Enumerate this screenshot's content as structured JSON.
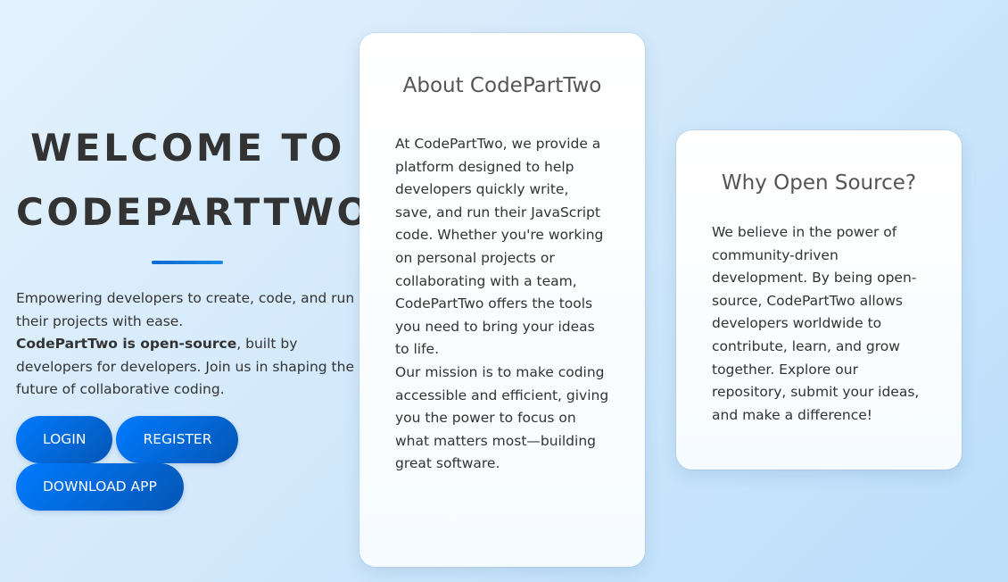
{
  "hero": {
    "title_line1": "WELCOME TO",
    "title_line2": "CODEPARTTWO",
    "intro": "Empowering developers to create, code, and run their projects with ease.",
    "open_source_strong": "CodePartTwo is open-source",
    "open_source_rest": ", built by developers for developers. Join us in shaping the future of collaborative coding.",
    "buttons": {
      "login": "LOGIN",
      "register": "REGISTER",
      "download": "DOWNLOAD APP"
    }
  },
  "about_card": {
    "title": "About CodePartTwo",
    "paragraph1": "At CodePartTwo, we provide a platform designed to help developers quickly write, save, and run their JavaScript code. Whether you're working on personal projects or collaborating with a team, CodePartTwo offers the tools you need to bring your ideas to life.",
    "paragraph2": "Our mission is to make coding accessible and efficient, giving you the power to focus on what matters most—building great software."
  },
  "why_card": {
    "title": "Why Open Source?",
    "paragraph": "We believe in the power of community-driven development. By being open-source, CodePartTwo allows developers worldwide to contribute, learn, and grow together. Explore our repository, submit your ideas, and make a difference!"
  },
  "colors": {
    "background_start": "#e3f2fd",
    "background_end": "#bbdefb",
    "button_start": "#007bff",
    "button_end": "#0556b4",
    "heading_text": "#333333",
    "card_title": "#555555"
  }
}
